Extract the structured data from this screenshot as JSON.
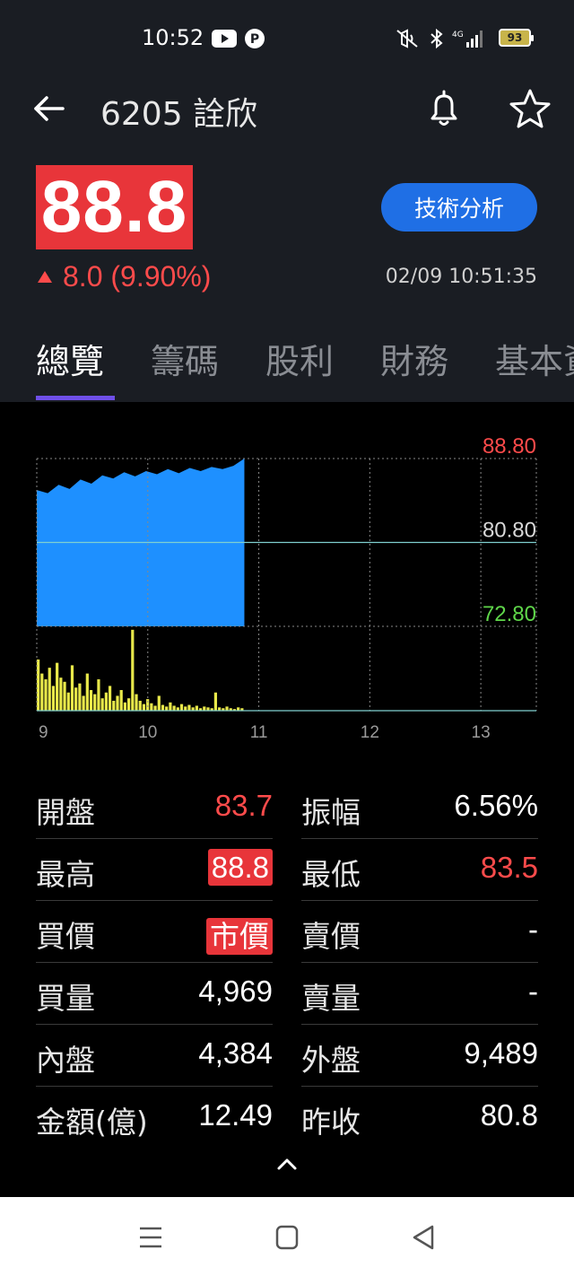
{
  "status_bar": {
    "time": "10:52",
    "battery": "93",
    "network": "4G"
  },
  "header": {
    "title": "6205 詮欣"
  },
  "quote": {
    "price": "88.8",
    "change": "8.0 (9.90%)",
    "timestamp": "02/09 10:51:35",
    "ta_button": "技術分析",
    "up_color": "#ff4b4b"
  },
  "tabs": [
    {
      "label": "總覽"
    },
    {
      "label": "籌碼"
    },
    {
      "label": "股利"
    },
    {
      "label": "財務"
    },
    {
      "label": "基本資"
    }
  ],
  "chart_data": {
    "type": "area",
    "price_series": {
      "color": "#1e90ff",
      "x_start": 9.0,
      "x_end": 10.87,
      "values": [
        85.8,
        85.5,
        86.3,
        85.9,
        86.8,
        86.4,
        87.2,
        86.9,
        87.5,
        87.1,
        87.6,
        87.3,
        87.8,
        87.4,
        87.9,
        87.6,
        88.0,
        87.8,
        88.1,
        88.8
      ]
    },
    "volume_series": {
      "color": "#e8e84a",
      "values": [
        0.62,
        0.45,
        0.38,
        0.52,
        0.3,
        0.58,
        0.4,
        0.35,
        0.22,
        0.55,
        0.28,
        0.33,
        0.18,
        0.45,
        0.25,
        0.2,
        0.38,
        0.15,
        0.22,
        0.3,
        0.12,
        0.18,
        0.25,
        0.1,
        0.15,
        0.98,
        0.2,
        0.12,
        0.08,
        0.14,
        0.09,
        0.06,
        0.18,
        0.07,
        0.05,
        0.1,
        0.06,
        0.04,
        0.08,
        0.05,
        0.07,
        0.04,
        0.06,
        0.03,
        0.05,
        0.04,
        0.03,
        0.22,
        0.04,
        0.03,
        0.05,
        0.03,
        0.02,
        0.04,
        0.03
      ]
    },
    "y_labels": [
      {
        "label": "88.80",
        "value": 88.8,
        "color": "#ff4b4b"
      },
      {
        "label": "80.80",
        "value": 80.8,
        "color": "#d8d8d8"
      },
      {
        "label": "72.80",
        "value": 72.8,
        "color": "#5fd64a"
      }
    ],
    "x_ticks": [
      "9",
      "10",
      "11",
      "12",
      "13"
    ],
    "ylim": [
      72.8,
      88.8
    ],
    "xlim": [
      9,
      13.5
    ],
    "grid": true
  },
  "stats": [
    {
      "l_label": "開盤",
      "l_value": "83.7",
      "l_color": "red",
      "r_label": "振幅",
      "r_value": "6.56%",
      "r_color": "white"
    },
    {
      "l_label": "最高",
      "l_value": "88.8",
      "l_color": "hl",
      "r_label": "最低",
      "r_value": "83.5",
      "r_color": "red"
    },
    {
      "l_label": "買價",
      "l_value": "市價",
      "l_color": "hl",
      "r_label": "賣價",
      "r_value": "-",
      "r_color": "white"
    },
    {
      "l_label": "買量",
      "l_value": "4,969",
      "l_color": "white",
      "r_label": "賣量",
      "r_value": "-",
      "r_color": "white"
    },
    {
      "l_label": "內盤",
      "l_value": "4,384",
      "l_color": "white",
      "r_label": "外盤",
      "r_value": "9,489",
      "r_color": "white"
    },
    {
      "l_label": "金額(億)",
      "l_value": "12.49",
      "l_color": "white",
      "r_label": "昨收",
      "r_value": "80.8",
      "r_color": "white"
    }
  ]
}
